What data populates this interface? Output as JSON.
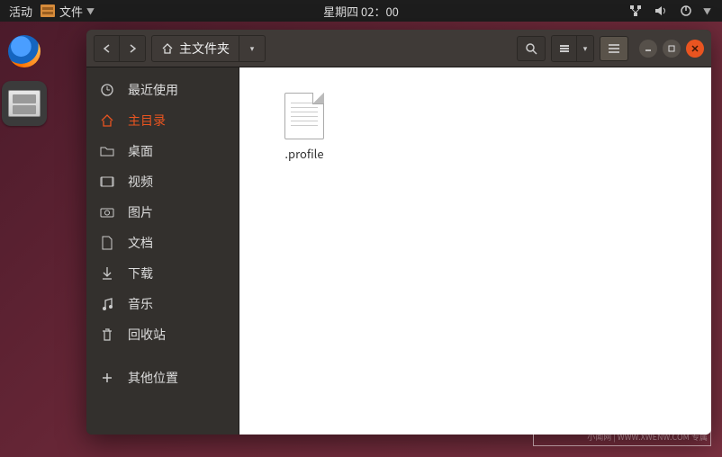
{
  "top_panel": {
    "activities": "活动",
    "app_menu": "文件",
    "clock": "星期四 02：00"
  },
  "dock": {
    "firefox": "firefox",
    "files": "files"
  },
  "window": {
    "path": {
      "label": "主文件夹"
    },
    "toolbar": {
      "search": "search",
      "view_grid": "grid",
      "view_list": "list"
    },
    "sidebar": {
      "items": [
        {
          "id": "recent",
          "label": "最近使用"
        },
        {
          "id": "home",
          "label": "主目录"
        },
        {
          "id": "desktop",
          "label": "桌面"
        },
        {
          "id": "videos",
          "label": "视频"
        },
        {
          "id": "pictures",
          "label": "图片"
        },
        {
          "id": "documents",
          "label": "文档"
        },
        {
          "id": "downloads",
          "label": "下载"
        },
        {
          "id": "music",
          "label": "音乐"
        },
        {
          "id": "trash",
          "label": "回收站"
        },
        {
          "id": "other",
          "label": "其他位置"
        }
      ]
    },
    "files": [
      {
        "name": ".profile"
      }
    ]
  },
  "watermark": {
    "text": "小闻网",
    "sub": "小闻网 | WWW.XWENW.COM 专属"
  }
}
